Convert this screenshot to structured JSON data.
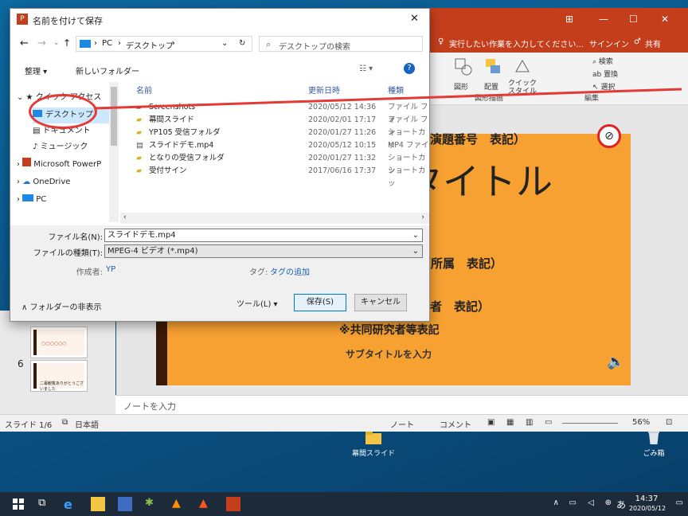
{
  "desktop": {
    "icons": [
      {
        "label": "幕間スライド"
      },
      {
        "label": "ごみ箱"
      }
    ]
  },
  "ppt": {
    "tell_me": "実行したい作業を入力してください...",
    "signin": "サインイン",
    "share": "共有",
    "ribbon": {
      "search": "検索",
      "replace": "置換",
      "select": "選択",
      "shape": "図形",
      "arrange": "配置",
      "quickstyle": "クイック スタイル",
      "group_drawing": "図形描画",
      "group_edit": "編集"
    },
    "slide": {
      "line1": "名，演題番号　表記）",
      "title": "タイトル",
      "affil": "（所属　表記）",
      "author": "者　表記）",
      "coauthor": "※共同研究者等表記",
      "subtitle": "サブタイトルを入力"
    },
    "thumbs": [
      {
        "num": "",
        "text": "○○○○○○"
      },
      {
        "num": "6",
        "text": "二幕観覧ありがとうございました"
      }
    ],
    "notes_placeholder": "ノートを入力",
    "status": {
      "slide": "スライド 1/6",
      "lang": "日本語",
      "notes": "ノート",
      "comments": "コメント",
      "zoom": "56%"
    }
  },
  "dialog": {
    "title": "名前を付けて保存",
    "breadcrumb": [
      "PC",
      "デスクトップ"
    ],
    "search_placeholder": "デスクトップの検索",
    "organize": "整理",
    "new_folder": "新しいフォルダー",
    "nav": [
      {
        "label": "クイック アクセス"
      },
      {
        "label": "デスクトップ"
      },
      {
        "label": "ドキュメント"
      },
      {
        "label": "ミュージック"
      },
      {
        "label": "Microsoft PowerP"
      },
      {
        "label": "OneDrive"
      },
      {
        "label": "PC"
      }
    ],
    "columns": {
      "name": "名前",
      "date": "更新日時",
      "type": "種類"
    },
    "files": [
      {
        "name": "Screenshots",
        "date": "2020/05/12 14:36",
        "type": "ファイル フォ"
      },
      {
        "name": "幕間スライド",
        "date": "2020/02/01 17:17",
        "type": "ファイル フォ"
      },
      {
        "name": "YP105 受信フォルダ",
        "date": "2020/01/27 11:26",
        "type": "ショートカッ"
      },
      {
        "name": "スライドデモ.mp4",
        "date": "2020/05/12 10:15",
        "type": "MP4 ファイ"
      },
      {
        "name": "となりの受信フォルダ",
        "date": "2020/01/27 11:32",
        "type": "ショートカッ"
      },
      {
        "name": "受付サイン",
        "date": "2017/06/16 17:37",
        "type": "ショートカッ"
      }
    ],
    "filename_label": "ファイル名(N):",
    "filename_value": "スライドデモ.mp4",
    "filetype_label": "ファイルの種類(T):",
    "filetype_value": "MPEG-4 ビデオ (*.mp4)",
    "author_label": "作成者:",
    "author_value": "YP",
    "tags_label": "タグ:",
    "tags_value": "タグの追加",
    "hide_folders": "フォルダーの非表示",
    "tools": "ツール(L)",
    "save": "保存(S)",
    "cancel": "キャンセル"
  },
  "taskbar": {
    "time": "14:37",
    "date": "2020/05/12",
    "ime": "あ"
  },
  "colors": {
    "ppt_red": "#c43e1c",
    "slide_orange": "#f7a132",
    "annotation_red": "#e53935",
    "selection": "#cce8ff"
  }
}
